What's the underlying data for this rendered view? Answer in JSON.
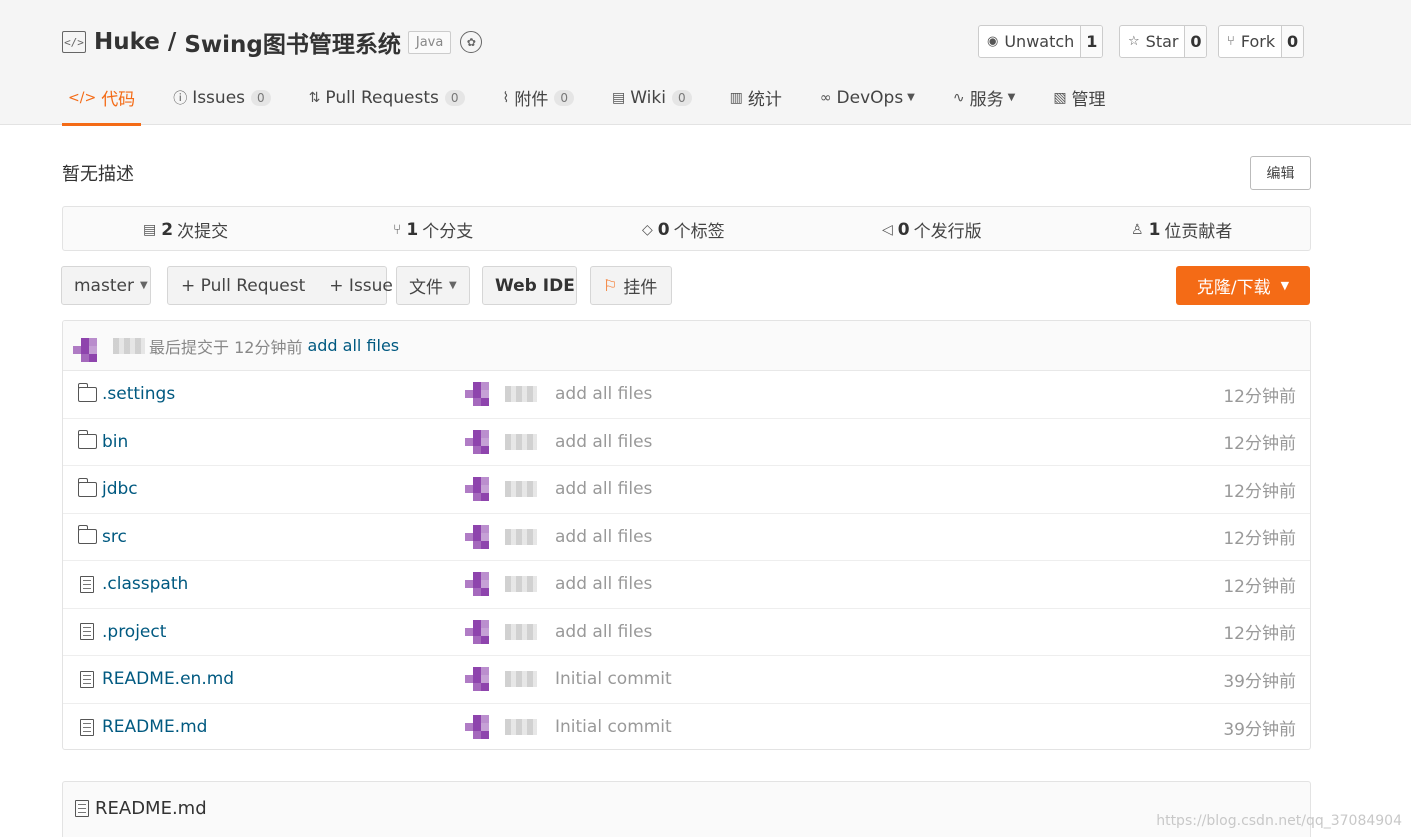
{
  "repo": {
    "owner": "Huke",
    "separator": " / ",
    "name": "Swing图书管理系统",
    "language": "Java"
  },
  "social": {
    "watch": {
      "label": "Unwatch",
      "count": "1"
    },
    "star": {
      "label": "Star",
      "count": "0"
    },
    "fork": {
      "label": "Fork",
      "count": "0"
    }
  },
  "nav": {
    "code": "代码",
    "issues": {
      "label": "Issues",
      "count": "0"
    },
    "pull_requests": {
      "label": "Pull Requests",
      "count": "0"
    },
    "attachments": {
      "label": "附件",
      "count": "0"
    },
    "wiki": {
      "label": "Wiki",
      "count": "0"
    },
    "stats": "统计",
    "devops": "DevOps",
    "services": "服务",
    "manage": "管理"
  },
  "description": "暂无描述",
  "edit_label": "编辑",
  "stats": {
    "commits": {
      "count": "2",
      "label": "次提交"
    },
    "branches": {
      "count": "1",
      "label": "个分支"
    },
    "tags": {
      "count": "0",
      "label": "个标签"
    },
    "releases": {
      "count": "0",
      "label": "个发行版"
    },
    "contributors": {
      "count": "1",
      "label": "位贡献者"
    }
  },
  "toolbar": {
    "branch": "master",
    "pull_request": "+ Pull Request",
    "issue": "+ Issue",
    "file": "文件",
    "web_ide": "Web IDE",
    "widget": "挂件",
    "clone": "克隆/下载"
  },
  "last_commit": {
    "prefix": "最后提交于 12分钟前",
    "message": "add all files"
  },
  "files": [
    {
      "name": ".settings",
      "type": "folder",
      "message": "add all files",
      "time": "12分钟前"
    },
    {
      "name": "bin",
      "type": "folder",
      "message": "add all files",
      "time": "12分钟前"
    },
    {
      "name": "jdbc",
      "type": "folder",
      "message": "add all files",
      "time": "12分钟前"
    },
    {
      "name": "src",
      "type": "folder",
      "message": "add all files",
      "time": "12分钟前"
    },
    {
      "name": ".classpath",
      "type": "file",
      "message": "add all files",
      "time": "12分钟前"
    },
    {
      "name": ".project",
      "type": "file",
      "message": "add all files",
      "time": "12分钟前"
    },
    {
      "name": "README.en.md",
      "type": "file",
      "message": "Initial commit",
      "time": "39分钟前"
    },
    {
      "name": "README.md",
      "type": "file",
      "message": "Initial commit",
      "time": "39分钟前"
    }
  ],
  "readme_title": "README.md",
  "watermark": "https://blog.csdn.net/qq_37084904",
  "colors": {
    "accent": "#f46b16",
    "link": "#005980",
    "avatar": "#8e44ad"
  }
}
